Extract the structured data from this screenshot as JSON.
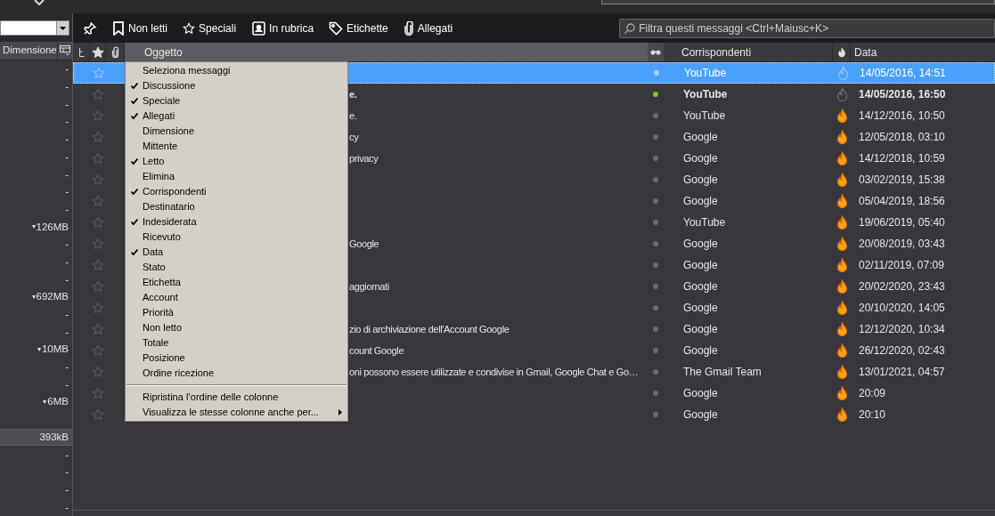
{
  "folder_pane": {
    "column_header": "Dimensione",
    "rows": [
      {
        "size": "-",
        "selected": false
      },
      {
        "size": "-",
        "selected": false
      },
      {
        "size": "-",
        "selected": false
      },
      {
        "size": "-",
        "selected": false
      },
      {
        "size": "-",
        "selected": false
      },
      {
        "size": "-",
        "selected": false
      },
      {
        "size": "-",
        "selected": false
      },
      {
        "size": "-",
        "selected": false
      },
      {
        "size": "-",
        "selected": false
      },
      {
        "marker": "▾",
        "size": "126MB",
        "selected": false
      },
      {
        "size": "-",
        "selected": false
      },
      {
        "size": "-",
        "selected": false
      },
      {
        "size": "-",
        "selected": false
      },
      {
        "marker": "▾",
        "size": "692MB",
        "selected": false
      },
      {
        "size": "-",
        "selected": false
      },
      {
        "size": "-",
        "selected": false
      },
      {
        "marker": "▾",
        "size": "10MB",
        "selected": false
      },
      {
        "size": "-",
        "selected": false
      },
      {
        "size": "-",
        "selected": false
      },
      {
        "marker": "▾",
        "size": "6MB",
        "selected": false
      },
      {
        "selected": false
      },
      {
        "size": "393kB",
        "selected": true
      },
      {
        "size": "-",
        "selected": false
      },
      {
        "size": "-",
        "selected": false
      },
      {
        "size": "-",
        "selected": false
      },
      {
        "size": "-",
        "selected": false
      }
    ]
  },
  "quick_filter": {
    "buttons": [
      {
        "kind": "pin"
      },
      {
        "kind": "unread",
        "label": "Non letti"
      },
      {
        "kind": "starred",
        "label": "Speciali"
      },
      {
        "kind": "contact",
        "label": "In rubrica"
      },
      {
        "kind": "tag",
        "label": "Etichette"
      },
      {
        "kind": "attachment",
        "label": "Allegati"
      }
    ],
    "search": {
      "placeholder": "Filtra questi messaggi <Ctrl+Maiusc+K>"
    }
  },
  "columns": {
    "subject": "Oggetto",
    "sender": "Corrispondenti",
    "date": "Data"
  },
  "messages": [
    {
      "sender": "YouTube",
      "date": "14/05/2016, 14:51",
      "selected": true,
      "unread": false,
      "junk": false
    },
    {
      "subject": "e.",
      "sender": "YouTube",
      "date": "14/05/2016, 16:50",
      "selected": false,
      "unread": true,
      "junk": false
    },
    {
      "subject": "e.",
      "sender": "YouTube",
      "date": "14/12/2016, 10:50",
      "selected": false,
      "unread": false,
      "junk": true
    },
    {
      "subject": "cy",
      "sender": "Google",
      "date": "12/05/2018, 03:10",
      "selected": false,
      "unread": false,
      "junk": true
    },
    {
      "subject": "privacy",
      "sender": "Google",
      "date": "14/12/2018, 10:59",
      "selected": false,
      "unread": false,
      "junk": true
    },
    {
      "sender": "Google",
      "date": "03/02/2019, 15:38",
      "selected": false,
      "unread": false,
      "junk": true
    },
    {
      "sender": "Google",
      "date": "05/04/2019, 18:56",
      "selected": false,
      "unread": false,
      "junk": true
    },
    {
      "sender": "YouTube",
      "date": "19/06/2019, 05:40",
      "selected": false,
      "unread": false,
      "junk": true
    },
    {
      "subject": "Google",
      "sender": "Google",
      "date": "20/08/2019, 03:43",
      "selected": false,
      "unread": false,
      "junk": true
    },
    {
      "sender": "Google",
      "date": "02/11/2019, 07:09",
      "selected": false,
      "unread": false,
      "junk": true
    },
    {
      "subject": "aggiornati",
      "sender": "Google",
      "date": "20/02/2020, 23:43",
      "selected": false,
      "unread": false,
      "junk": true
    },
    {
      "sender": "Google",
      "date": "20/10/2020, 14:05",
      "selected": false,
      "unread": false,
      "junk": true
    },
    {
      "subject": "zio di archiviazione dell'Account Google",
      "sender": "Google",
      "date": "12/12/2020, 10:34",
      "selected": false,
      "unread": false,
      "junk": true
    },
    {
      "subject": "count Google",
      "sender": "Google",
      "date": "26/12/2020, 02:43",
      "selected": false,
      "unread": false,
      "junk": true
    },
    {
      "subject": "oni possono essere utilizzate e condivise in Gmail, Google Chat e Go…",
      "sender": "The Gmail Team",
      "date": "13/01/2021, 04:57",
      "selected": false,
      "unread": false,
      "junk": true
    },
    {
      "sender": "Google",
      "date": "20:09",
      "selected": false,
      "unread": false,
      "junk": true
    },
    {
      "sender": "Google",
      "date": "20:10",
      "selected": false,
      "unread": false,
      "junk": true
    }
  ],
  "column_menu": {
    "items": [
      {
        "label": "Seleziona messaggi",
        "checked": false
      },
      {
        "label": "Discussione",
        "checked": true
      },
      {
        "label": "Speciale",
        "checked": true
      },
      {
        "label": "Allegati",
        "checked": true
      },
      {
        "label": "Dimensione",
        "checked": false
      },
      {
        "label": "Mittente",
        "checked": false
      },
      {
        "label": "Letto",
        "checked": true
      },
      {
        "label": "Elimina",
        "checked": false
      },
      {
        "label": "Corrispondenti",
        "checked": true
      },
      {
        "label": "Destinatario",
        "checked": false
      },
      {
        "label": "Indesiderata",
        "checked": true
      },
      {
        "label": "Ricevuto",
        "checked": false
      },
      {
        "label": "Data",
        "checked": true
      },
      {
        "label": "Stato",
        "checked": false
      },
      {
        "label": "Etichetta",
        "checked": false
      },
      {
        "label": "Account",
        "checked": false
      },
      {
        "label": "Priorità",
        "checked": false
      },
      {
        "label": "Non letto",
        "checked": false
      },
      {
        "label": "Totale",
        "checked": false
      },
      {
        "label": "Posizione",
        "checked": false
      },
      {
        "label": "Ordine ricezione",
        "checked": false
      }
    ],
    "actions": [
      {
        "label": "Ripristina l’ordine delle colonne",
        "submenu": false
      },
      {
        "label": "Visualizza le stesse colonne anche per...",
        "submenu": true
      }
    ]
  }
}
